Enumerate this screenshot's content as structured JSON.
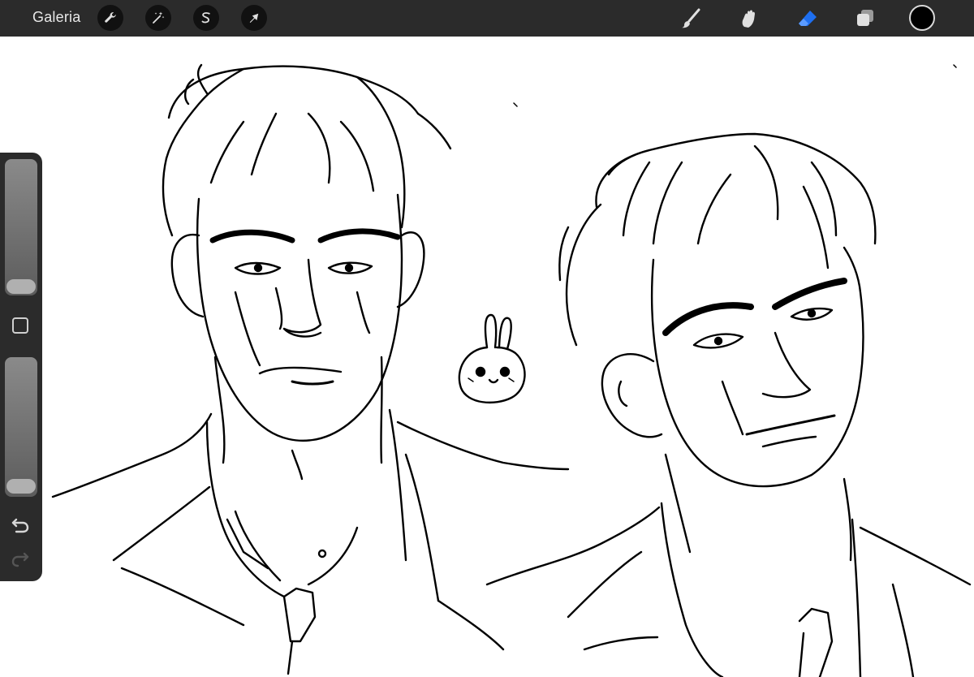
{
  "topbar": {
    "gallery_label": "Galeria",
    "left_tools": [
      {
        "name": "wrench-icon",
        "purpose": "actions"
      },
      {
        "name": "magic-wand-icon",
        "purpose": "adjustments"
      },
      {
        "name": "selection-s-icon",
        "purpose": "selection"
      },
      {
        "name": "arrow-cursor-icon",
        "purpose": "transform"
      }
    ],
    "right_tools": [
      {
        "name": "brush-icon",
        "state": "inactive"
      },
      {
        "name": "smudge-icon",
        "state": "inactive"
      },
      {
        "name": "eraser-icon",
        "state": "active"
      },
      {
        "name": "layers-icon",
        "state": "inactive"
      }
    ],
    "current_color": "#000000"
  },
  "sidebar": {
    "brush_size_level": 0.05,
    "opacity_level": 0.05,
    "icons": [
      "modify-square-icon",
      "undo-icon",
      "redo-icon"
    ]
  },
  "colors": {
    "toolbar_bg": "#2b2b2b",
    "active_tool": "#1e6ff0",
    "icon": "#e0e0e0",
    "canvas": "#ffffff"
  }
}
